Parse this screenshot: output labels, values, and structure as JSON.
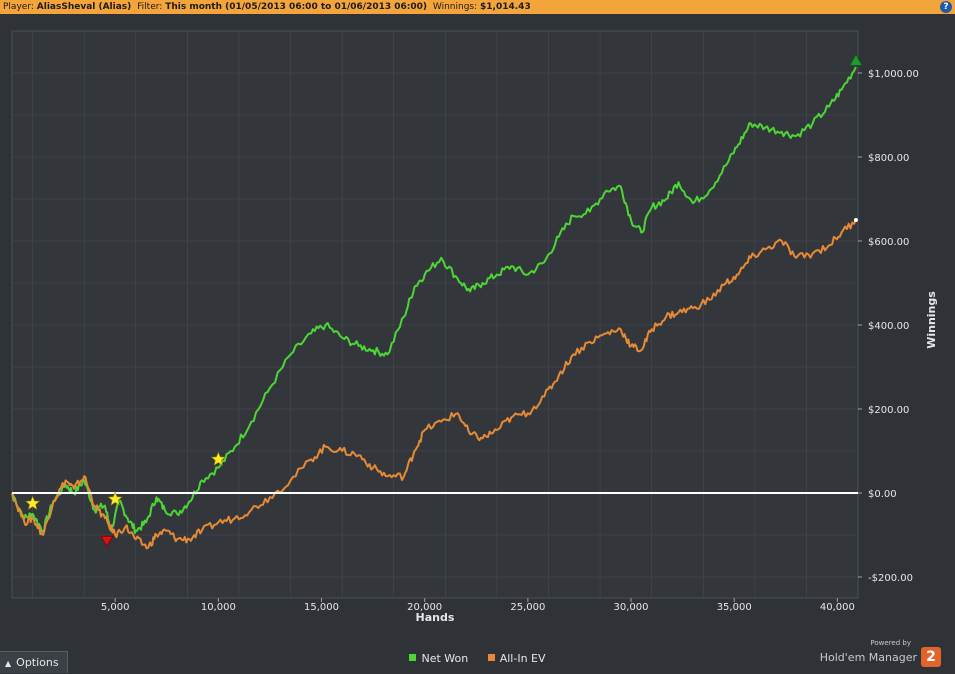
{
  "header": {
    "player_label": "Player:",
    "player_value": "AliasSheval (Alias)",
    "filter_label": "Filter:",
    "filter_value": "This month (01/05/2013 06:00 to 01/06/2013 06:00)",
    "winnings_label": "Winnings:",
    "winnings_value": "$1,014.43",
    "help_icon": "help-icon",
    "help_glyph": "?"
  },
  "footer": {
    "options_label": "Options",
    "options_icon": "chevron-up-icon",
    "brand_powered": "Powered by",
    "brand_name": "Hold'em Manager",
    "brand_logo": "2"
  },
  "colors": {
    "net_won": "#4cd635",
    "all_in_ev": "#e88a35",
    "zero_line": "#ffffff",
    "grid": "#464b52",
    "plot_bg": "#33373c",
    "star": "#ffea2a",
    "marker_down": "#d21414",
    "marker_up": "#1f9a2f"
  },
  "chart_data": {
    "type": "line",
    "xlabel": "Hands",
    "ylabel": "Winnings",
    "xlim": [
      0,
      41000
    ],
    "ylim": [
      -250,
      1100
    ],
    "xticks": [
      5000,
      10000,
      15000,
      20000,
      25000,
      30000,
      35000,
      40000
    ],
    "xtick_labels": [
      "5,000",
      "10,000",
      "15,000",
      "20,000",
      "25,000",
      "30,000",
      "35,000",
      "40,000"
    ],
    "yticks": [
      -200,
      0,
      200,
      400,
      600,
      800,
      1000
    ],
    "ytick_labels": [
      "-$200.00",
      "$0.00",
      "$200.00",
      "$400.00",
      "$600.00",
      "$800.00",
      "$1,000.00"
    ],
    "grid": true,
    "legend_position": "bottom-center",
    "series": [
      {
        "name": "Net Won",
        "x": [
          0,
          600,
          1000,
          1500,
          2000,
          2600,
          3000,
          3500,
          4000,
          4500,
          4800,
          5200,
          5600,
          6000,
          6500,
          7000,
          7400,
          8000,
          8600,
          9200,
          10000,
          10800,
          11600,
          12500,
          13500,
          14500,
          15200,
          16000,
          16800,
          17500,
          18200,
          19000,
          19500,
          20000,
          20800,
          21600,
          22200,
          22800,
          23500,
          24200,
          25000,
          25800,
          26500,
          27200,
          28000,
          28800,
          29500,
          30000,
          30500,
          31000,
          31700,
          32300,
          33000,
          33800,
          34600,
          35200,
          35800,
          36500,
          37300,
          38000,
          38800,
          39600,
          40200,
          40900
        ],
        "y": [
          0,
          -60,
          -50,
          -90,
          -20,
          20,
          0,
          30,
          -40,
          -30,
          -90,
          -20,
          -60,
          -90,
          -70,
          -10,
          -40,
          -50,
          -20,
          30,
          60,
          110,
          170,
          250,
          330,
          380,
          400,
          370,
          350,
          340,
          330,
          420,
          490,
          520,
          560,
          510,
          480,
          500,
          520,
          540,
          520,
          550,
          610,
          660,
          670,
          720,
          730,
          650,
          620,
          680,
          700,
          740,
          690,
          720,
          780,
          830,
          880,
          870,
          860,
          850,
          880,
          920,
          960,
          1014
        ]
      },
      {
        "name": "All-In EV",
        "x": [
          0,
          600,
          1000,
          1500,
          2000,
          2600,
          3000,
          3500,
          4000,
          4500,
          5000,
          5500,
          6000,
          6600,
          7000,
          7500,
          8000,
          8600,
          9200,
          10000,
          10800,
          11600,
          12500,
          13500,
          14500,
          15200,
          16000,
          16800,
          17500,
          18200,
          19000,
          19500,
          20000,
          20800,
          21600,
          22200,
          22800,
          23500,
          24200,
          25000,
          25800,
          26500,
          27200,
          28000,
          28800,
          29500,
          30000,
          30500,
          31000,
          31700,
          32300,
          33000,
          33800,
          34600,
          35200,
          35800,
          36500,
          37300,
          38000,
          38800,
          39600,
          40200,
          40900
        ],
        "y": [
          0,
          -70,
          -60,
          -100,
          -20,
          30,
          10,
          40,
          -30,
          -60,
          -100,
          -80,
          -110,
          -130,
          -100,
          -90,
          -110,
          -110,
          -90,
          -70,
          -60,
          -40,
          -10,
          30,
          80,
          110,
          100,
          90,
          60,
          40,
          40,
          100,
          150,
          170,
          190,
          140,
          130,
          150,
          180,
          190,
          230,
          280,
          330,
          360,
          380,
          390,
          350,
          340,
          390,
          420,
          430,
          440,
          460,
          500,
          520,
          560,
          580,
          600,
          560,
          570,
          590,
          620,
          650
        ]
      }
    ],
    "markers": [
      {
        "type": "star",
        "x": 1000,
        "y": -25
      },
      {
        "type": "star",
        "x": 5000,
        "y": -15
      },
      {
        "type": "star",
        "x": 10000,
        "y": 80
      },
      {
        "type": "down-triangle",
        "x": 4600,
        "y": -115
      },
      {
        "type": "up-triangle",
        "x": 40900,
        "y": 1030
      }
    ]
  }
}
